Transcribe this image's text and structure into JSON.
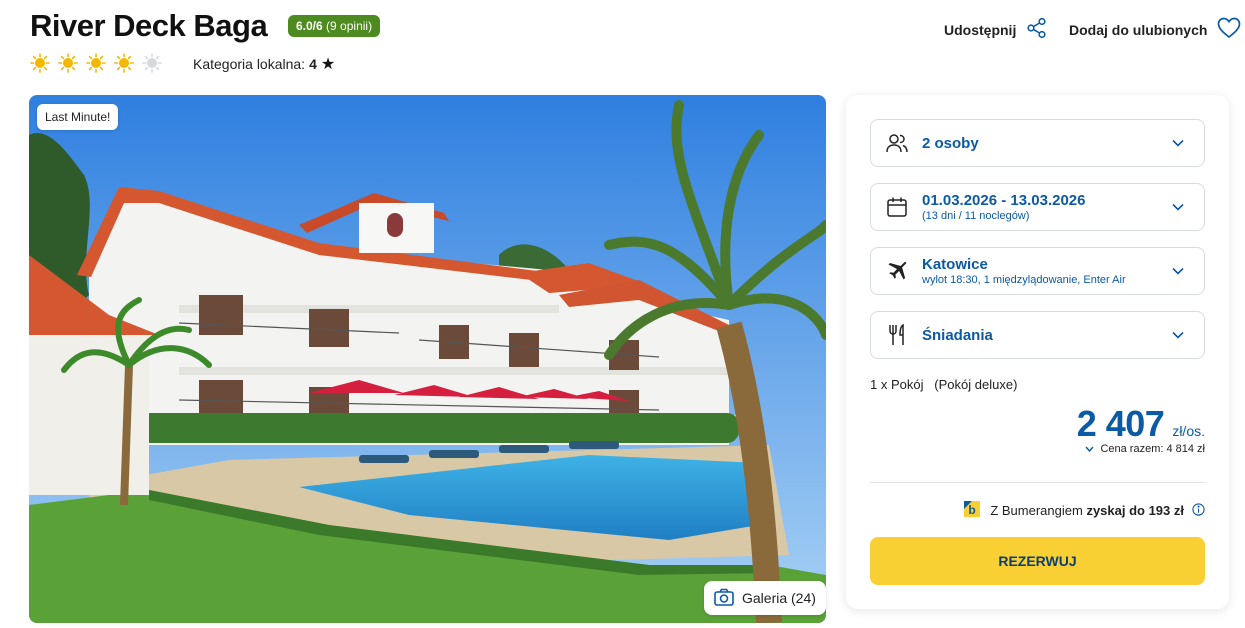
{
  "hotel": {
    "name": "River Deck Baga",
    "rating_score": "6.0/6",
    "rating_count": "(9 opinii)",
    "suns_filled": 4,
    "suns_total": 5,
    "category_label": "Kategoria lokalna:",
    "category_value": "4"
  },
  "actions": {
    "share_label": "Udostępnij",
    "favorite_label": "Dodaj do ulubionych"
  },
  "photo": {
    "badge": "Last Minute!",
    "gallery_label": "Galeria (24)"
  },
  "booking": {
    "persons": "2 osoby",
    "dates": "01.03.2026 - 13.03.2026",
    "dates_sub": "(13 dni / 11 noclegów)",
    "departure": "Katowice",
    "departure_sub": "wylot 18:30, 1 międzylądowanie, Enter Air",
    "board": "Śniadania",
    "room": "1 x Pokój   (Pokój deluxe)",
    "price": "2 407",
    "price_unit": "zł/os.",
    "total_label": "Cena razem: 4 814 zł",
    "bumerang_prefix": "Z Bumerangiem",
    "bumerang_bold": "zyskaj do 193 zł",
    "reserve_label": "REZERWUJ"
  },
  "colors": {
    "accent_blue": "#0b5aa6",
    "reserve_yellow": "#f9d033",
    "rating_green": "#4d8a1f",
    "sun_gold": "#f5b800"
  }
}
